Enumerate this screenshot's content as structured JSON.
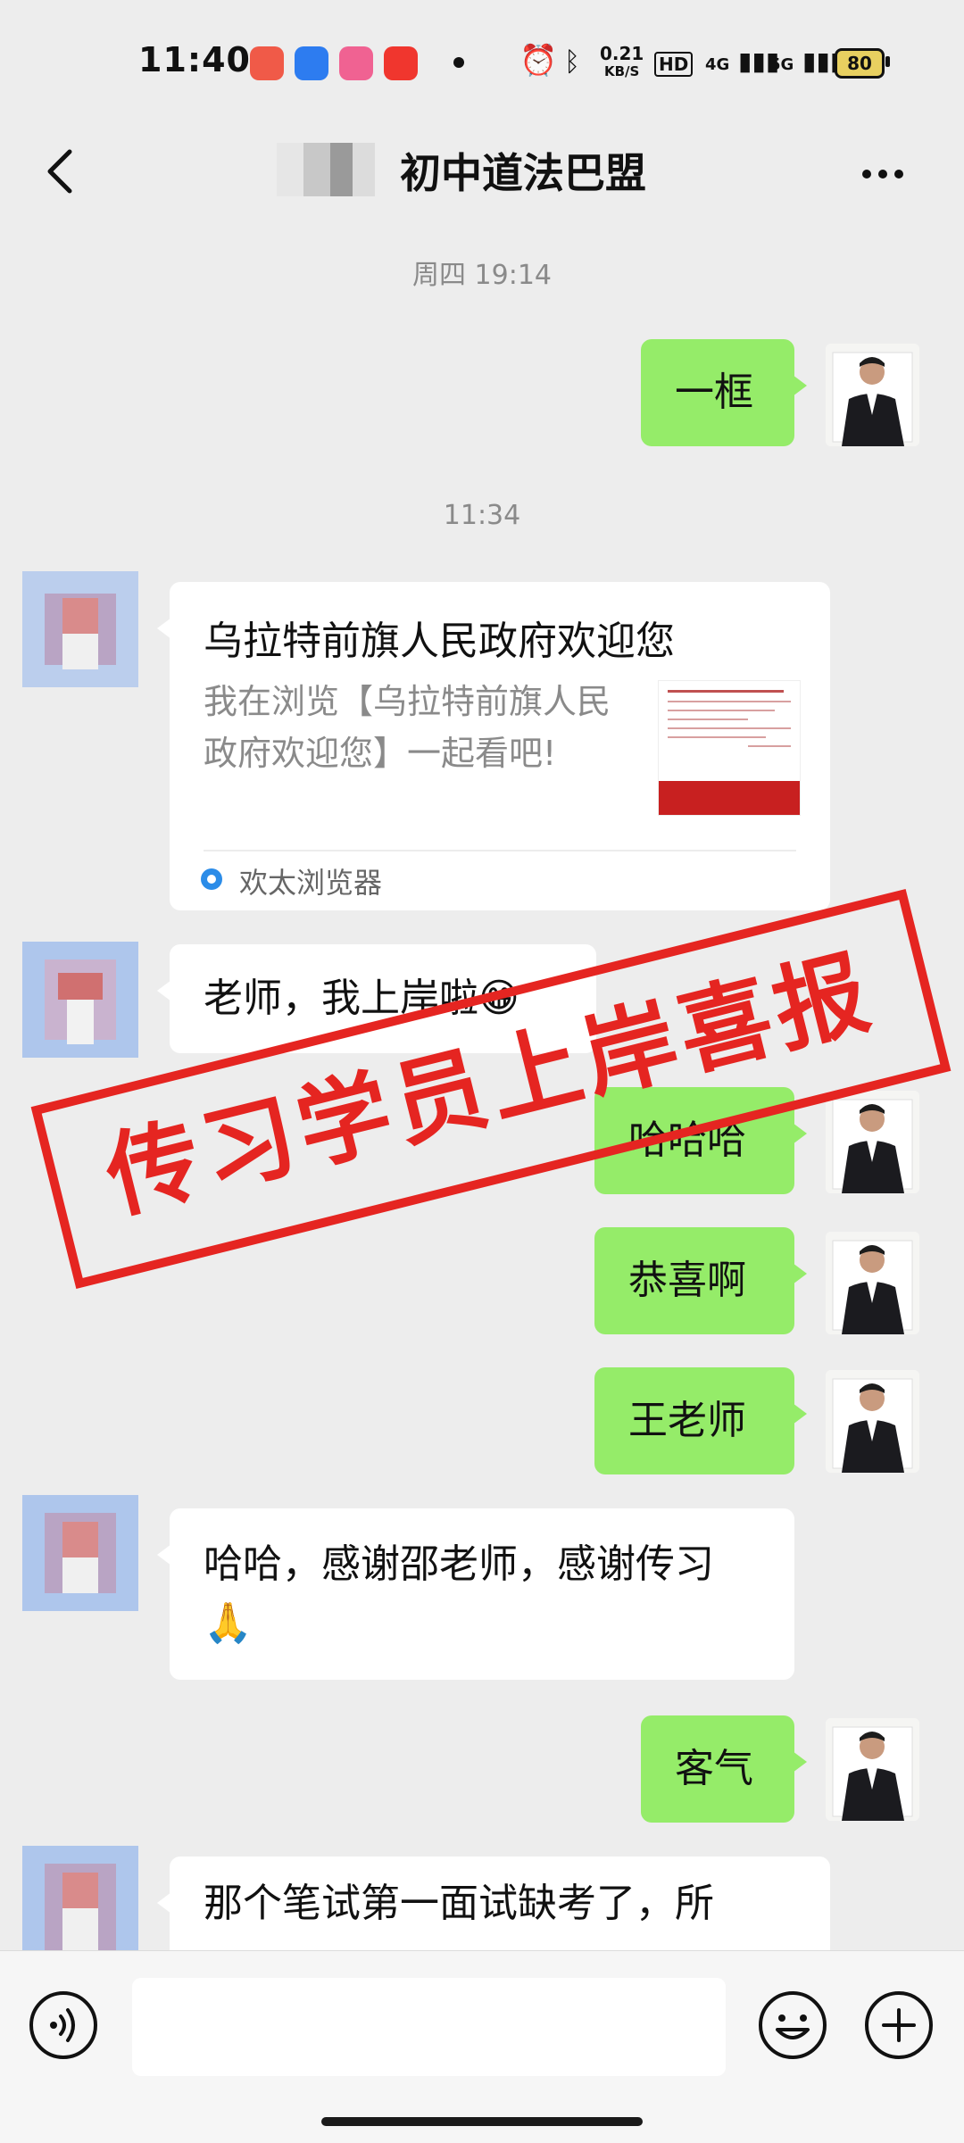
{
  "status": {
    "time": "11:40",
    "net_speed_value": "0.21",
    "net_speed_unit": "KB/S",
    "hd": "HD",
    "signal1": "4G",
    "signal2": "5G",
    "battery": "80"
  },
  "header": {
    "title": "初中道法巴盟"
  },
  "messages": {
    "ts1": "周四 19:14",
    "m1": "一框",
    "ts2": "11:34",
    "card": {
      "title": "乌拉特前旗人民政府欢迎您",
      "desc": "我在浏览【乌拉特前旗人民政府欢迎您】一起看吧!",
      "source": "欢太浏览器"
    },
    "m2": "老师，我上岸啦",
    "m3": "哈哈哈",
    "m4": "恭喜啊",
    "m5": "王老师",
    "m6": "哈哈，感谢邵老师，感谢传习",
    "m7": "客气",
    "m8": "那个笔试第一面试缺考了，所"
  },
  "stamp": {
    "text": "传习学员上岸喜报"
  },
  "colors": {
    "me_bubble": "#95ec69",
    "stamp_red": "#e52521",
    "background": "#ededed"
  },
  "icons": [
    "back-icon",
    "more-icon",
    "voice-icon",
    "emoji-icon",
    "plus-icon",
    "alarm-icon",
    "bluetooth-icon"
  ]
}
